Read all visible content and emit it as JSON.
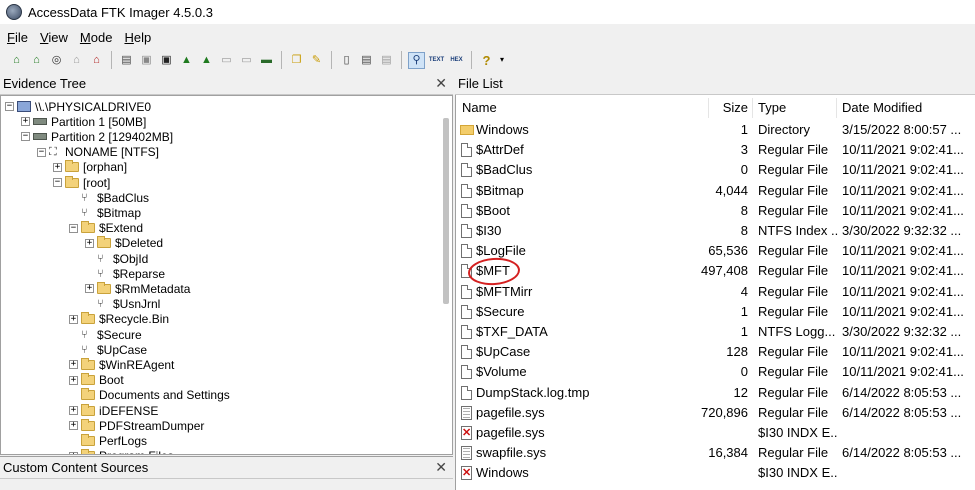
{
  "window": {
    "title": "AccessData FTK Imager 4.5.0.3"
  },
  "menu": [
    {
      "u": "F",
      "rest": "ile"
    },
    {
      "u": "V",
      "rest": "iew"
    },
    {
      "u": "M",
      "rest": "ode"
    },
    {
      "u": "H",
      "rest": "elp"
    }
  ],
  "toolbar_icons": [
    "add-evidence-item-icon",
    "add-all-attached-devices-icon",
    "image-mounting-icon",
    "remove-evidence-item-icon",
    "remove-all-evidence-icon",
    "create-disk-image-icon",
    "export-disk-image-icon",
    "export-logical-image-icon",
    "add-to-custom-content-icon",
    "create-custom-content-image-icon",
    "decrypt-ad1-icon",
    "verify-drive-icon",
    "capture-memory-icon",
    "obtain-protected-files-icon",
    "detect-efs-icon",
    "export-files-icon",
    "export-file-hash-list-icon",
    "export-directory-listing-icon",
    "auto-view-icon",
    "text-view-icon",
    "hex-view-icon",
    "help-icon"
  ],
  "toolbar_text": {
    "text": "TEXT",
    "hex": "HEX",
    "help": "?"
  },
  "evidence_tree": {
    "title": "Evidence Tree",
    "close": "✕",
    "items": [
      {
        "label": "\\\\.\\PHYSICALDRIVE0",
        "icon": "pc",
        "toggle": "−"
      },
      {
        "label": "Partition 1 [50MB]",
        "icon": "drive",
        "toggle": "+"
      },
      {
        "label": "Partition 2 [129402MB]",
        "icon": "drive",
        "toggle": "−"
      },
      {
        "label": "NONAME [NTFS]",
        "icon": "fs",
        "toggle": "−"
      },
      {
        "label": "[orphan]",
        "icon": "folder",
        "toggle": "+"
      },
      {
        "label": "[root]",
        "icon": "folder",
        "toggle": "−"
      },
      {
        "label": "$BadClus",
        "icon": "file",
        "toggle": ""
      },
      {
        "label": "$Bitmap",
        "icon": "file",
        "toggle": ""
      },
      {
        "label": "$Extend",
        "icon": "folder",
        "toggle": "−"
      },
      {
        "label": "$Deleted",
        "icon": "folder",
        "toggle": "+"
      },
      {
        "label": "$ObjId",
        "icon": "file",
        "toggle": ""
      },
      {
        "label": "$Reparse",
        "icon": "file",
        "toggle": ""
      },
      {
        "label": "$RmMetadata",
        "icon": "folder",
        "toggle": "+"
      },
      {
        "label": "$UsnJrnl",
        "icon": "file",
        "toggle": ""
      },
      {
        "label": "$Recycle.Bin",
        "icon": "folder",
        "toggle": "+"
      },
      {
        "label": "$Secure",
        "icon": "file",
        "toggle": ""
      },
      {
        "label": "$UpCase",
        "icon": "file",
        "toggle": ""
      },
      {
        "label": "$WinREAgent",
        "icon": "folder",
        "toggle": "+"
      },
      {
        "label": "Boot",
        "icon": "folder",
        "toggle": "+"
      },
      {
        "label": "Documents and Settings",
        "icon": "folder",
        "toggle": ""
      },
      {
        "label": "iDEFENSE",
        "icon": "folder",
        "toggle": "+"
      },
      {
        "label": "PDFStreamDumper",
        "icon": "folder",
        "toggle": "+"
      },
      {
        "label": "PerfLogs",
        "icon": "folder",
        "toggle": ""
      },
      {
        "label": "Program Files",
        "icon": "folder",
        "toggle": "+"
      }
    ]
  },
  "custom_content": {
    "title": "Custom Content Sources",
    "close": "✕"
  },
  "file_list": {
    "title": "File List",
    "headers": {
      "name": "Name",
      "size": "Size",
      "type": "Type",
      "date": "Date Modified"
    },
    "rows": [
      {
        "icon": "folder",
        "name": "Windows",
        "size": "1",
        "type": "Directory",
        "date": "3/15/2022 8:00:57 ..."
      },
      {
        "icon": "file",
        "name": "$AttrDef",
        "size": "3",
        "type": "Regular File",
        "date": "10/11/2021 9:02:41..."
      },
      {
        "icon": "file",
        "name": "$BadClus",
        "size": "0",
        "type": "Regular File",
        "date": "10/11/2021 9:02:41..."
      },
      {
        "icon": "file",
        "name": "$Bitmap",
        "size": "4,044",
        "type": "Regular File",
        "date": "10/11/2021 9:02:41..."
      },
      {
        "icon": "file",
        "name": "$Boot",
        "size": "8",
        "type": "Regular File",
        "date": "10/11/2021 9:02:41..."
      },
      {
        "icon": "file",
        "name": "$I30",
        "size": "8",
        "type": "NTFS Index ...",
        "date": "3/30/2022 9:32:32 ..."
      },
      {
        "icon": "file",
        "name": "$LogFile",
        "size": "65,536",
        "type": "Regular File",
        "date": "10/11/2021 9:02:41..."
      },
      {
        "icon": "file",
        "name": "$MFT",
        "size": "497,408",
        "type": "Regular File",
        "date": "10/11/2021 9:02:41..."
      },
      {
        "icon": "file",
        "name": "$MFTMirr",
        "size": "4",
        "type": "Regular File",
        "date": "10/11/2021 9:02:41..."
      },
      {
        "icon": "file",
        "name": "$Secure",
        "size": "1",
        "type": "Regular File",
        "date": "10/11/2021 9:02:41..."
      },
      {
        "icon": "file",
        "name": "$TXF_DATA",
        "size": "1",
        "type": "NTFS Logg...",
        "date": "3/30/2022 9:32:32 ..."
      },
      {
        "icon": "file",
        "name": "$UpCase",
        "size": "128",
        "type": "Regular File",
        "date": "10/11/2021 9:02:41..."
      },
      {
        "icon": "file",
        "name": "$Volume",
        "size": "0",
        "type": "Regular File",
        "date": "10/11/2021 9:02:41..."
      },
      {
        "icon": "file",
        "name": "DumpStack.log.tmp",
        "size": "12",
        "type": "Regular File",
        "date": "6/14/2022 8:05:53 ..."
      },
      {
        "icon": "lined",
        "name": "pagefile.sys",
        "size": "720,896",
        "type": "Regular File",
        "date": "6/14/2022 8:05:53 ..."
      },
      {
        "icon": "deleted",
        "name": "pagefile.sys",
        "size": "",
        "type": "$I30 INDX E...",
        "date": ""
      },
      {
        "icon": "lined",
        "name": "swapfile.sys",
        "size": "16,384",
        "type": "Regular File",
        "date": "6/14/2022 8:05:53 ..."
      },
      {
        "icon": "deleted",
        "name": "Windows",
        "size": "",
        "type": "$I30 INDX E...",
        "date": ""
      }
    ]
  },
  "colors": {
    "annotation": "#d42020",
    "folder": "#f3cd6b"
  }
}
